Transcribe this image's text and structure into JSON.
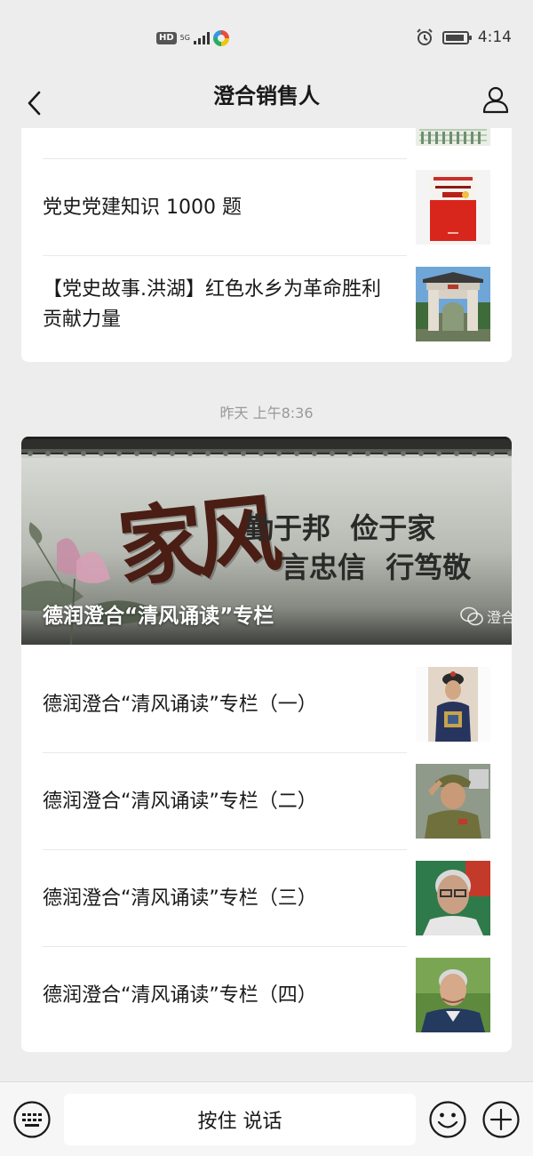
{
  "status_bar": {
    "hd": "HD",
    "network": "5G",
    "time": "4:14",
    "icons": [
      "hd-icon",
      "signal-icon",
      "app-notification-icon",
      "alarm-icon",
      "battery-icon"
    ]
  },
  "nav": {
    "title": "澄合销售人",
    "icons": [
      "back-arrow-icon",
      "profile-icon"
    ]
  },
  "top_card": {
    "items": [
      {
        "title": "党史党建知识 1000 题",
        "thumb_icon": "book-cover-thumbnail"
      },
      {
        "title": "【党史故事.洪湖】红色水乡为革命胜利贡献力量",
        "thumb_icon": "memorial-gate-thumbnail"
      }
    ]
  },
  "timestamp": "昨天 上午8:36",
  "main_card": {
    "cover_caption": "德润澄合“清风诵读”专栏",
    "cover_text": {
      "calligraphy": "家风",
      "line1": "勤于邦  俭于家",
      "line2": "言忠信  行笃敬",
      "watermark": "澄合"
    },
    "items": [
      {
        "title": "德润澄合“清风诵读”专栏（一）",
        "thumb_icon": "portrait-official-thumbnail"
      },
      {
        "title": "德润澄合“清风诵读”专栏（二）",
        "thumb_icon": "portrait-veteran-thumbnail"
      },
      {
        "title": "德润澄合“清风诵读”专栏（三）",
        "thumb_icon": "portrait-elder-thumbnail"
      },
      {
        "title": "德润澄合“清风诵读”专栏（四）",
        "thumb_icon": "portrait-man-thumbnail"
      }
    ]
  },
  "input_bar": {
    "hold_to_talk": "按住 说话",
    "icons": [
      "keyboard-icon",
      "emoji-icon",
      "plus-icon"
    ]
  },
  "colors": {
    "background": "#ededed",
    "card": "#ffffff",
    "text": "#191919",
    "timestamp": "#999999"
  }
}
